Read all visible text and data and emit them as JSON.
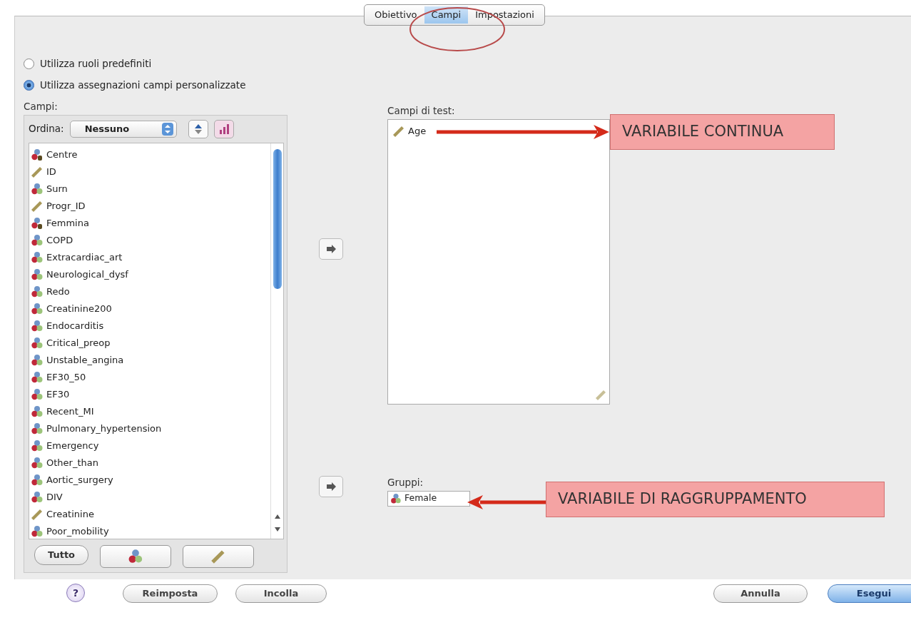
{
  "tabs": [
    {
      "label": "Obiettivo",
      "selected": false
    },
    {
      "label": "Campi",
      "selected": true
    },
    {
      "label": "Impostazioni",
      "selected": false
    }
  ],
  "role_options": [
    {
      "label": "Utilizza ruoli predefiniti",
      "selected": false
    },
    {
      "label": "Utilizza assegnazioni campi personalizzate",
      "selected": true
    }
  ],
  "fields_panel": {
    "label": "Campi:",
    "sort_label": "Ordina:",
    "sort_value": "Nessuno",
    "items": [
      {
        "name": "Centre",
        "kind": "nominal-string"
      },
      {
        "name": "ID",
        "kind": "scale"
      },
      {
        "name": "Surn",
        "kind": "nominal"
      },
      {
        "name": "Progr_ID",
        "kind": "scale"
      },
      {
        "name": "Femmina",
        "kind": "nominal-string"
      },
      {
        "name": "COPD",
        "kind": "nominal"
      },
      {
        "name": "Extracardiac_art",
        "kind": "nominal"
      },
      {
        "name": "Neurological_dysf",
        "kind": "nominal"
      },
      {
        "name": "Redo",
        "kind": "nominal"
      },
      {
        "name": "Creatinine200",
        "kind": "nominal"
      },
      {
        "name": "Endocarditis",
        "kind": "nominal"
      },
      {
        "name": "Critical_preop",
        "kind": "nominal"
      },
      {
        "name": "Unstable_angina",
        "kind": "nominal"
      },
      {
        "name": "EF30_50",
        "kind": "nominal"
      },
      {
        "name": "EF30",
        "kind": "nominal"
      },
      {
        "name": "Recent_MI",
        "kind": "nominal"
      },
      {
        "name": "Pulmonary_hypertension",
        "kind": "nominal"
      },
      {
        "name": "Emergency",
        "kind": "nominal"
      },
      {
        "name": "Other_than",
        "kind": "nominal"
      },
      {
        "name": "Aortic_surgery",
        "kind": "nominal"
      },
      {
        "name": "DIV",
        "kind": "nominal"
      },
      {
        "name": "Creatinine",
        "kind": "scale"
      },
      {
        "name": "Poor_mobility",
        "kind": "nominal"
      }
    ],
    "buttons": [
      {
        "kind": "text",
        "label": "Tutto"
      },
      {
        "kind": "nominal"
      },
      {
        "kind": "scale"
      }
    ]
  },
  "test_fields": {
    "label": "Campi di test:",
    "items": [
      {
        "name": "Age",
        "kind": "scale"
      }
    ]
  },
  "groups": {
    "label": "Gruppi:",
    "value": {
      "name": "Female",
      "kind": "nominal"
    }
  },
  "annotations": [
    {
      "text": "VARIABILE CONTINUA"
    },
    {
      "text": "VARIABILE DI RAGGRUPPAMENTO"
    }
  ],
  "footer": {
    "help": "?",
    "left_buttons": [
      "Reimposta",
      "Incolla"
    ],
    "right_buttons": [
      {
        "label": "Annulla",
        "default": false
      },
      {
        "label": "Esegui",
        "default": true
      }
    ]
  }
}
